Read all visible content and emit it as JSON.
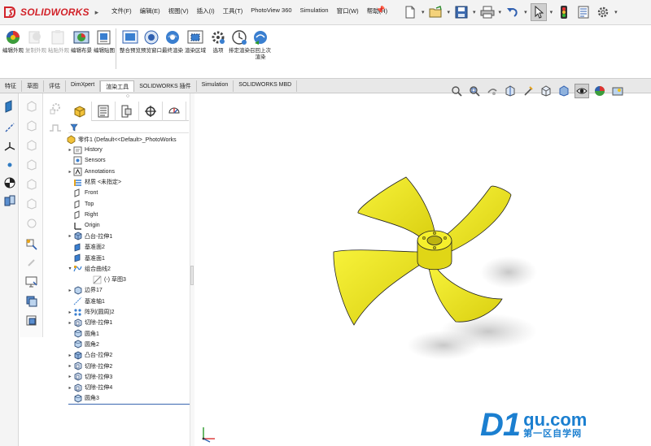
{
  "app": {
    "brand": "SOLIDWORKS",
    "menu": [
      "文件(F)",
      "编辑(E)",
      "视图(V)",
      "插入(I)",
      "工具(T)",
      "PhotoView 360",
      "Simulation",
      "窗口(W)",
      "帮助(H)"
    ]
  },
  "commands": [
    {
      "label": "编辑外观",
      "enabled": true
    },
    {
      "label": "复制外观",
      "enabled": false
    },
    {
      "label": "粘贴外观",
      "enabled": false
    },
    {
      "label": "编辑布景",
      "enabled": true
    },
    {
      "label": "编辑贴图",
      "enabled": true
    },
    {
      "label": "整合预览",
      "enabled": true
    },
    {
      "label": "预览窗口",
      "enabled": true
    },
    {
      "label": "最终渲染",
      "enabled": true
    },
    {
      "label": "渲染区域",
      "enabled": true
    },
    {
      "label": "选项",
      "enabled": true
    },
    {
      "label": "排定渲染",
      "enabled": true
    },
    {
      "label": "召回上次渲染",
      "enabled": true
    }
  ],
  "tabs": [
    "特征",
    "草图",
    "评估",
    "DimXpert",
    "渲染工具",
    "SOLIDWORKS 插件",
    "Simulation",
    "SOLIDWORKS MBD"
  ],
  "active_tab": "渲染工具",
  "tree": {
    "root": "零件1  (Default<<Default>_PhotoWorks",
    "items": [
      {
        "label": "History",
        "exp": "▸",
        "indent": 0,
        "icon": "history-icon"
      },
      {
        "label": "Sensors",
        "exp": "",
        "indent": 0,
        "icon": "sensors-icon"
      },
      {
        "label": "Annotations",
        "exp": "▸",
        "indent": 0,
        "icon": "annotations-icon"
      },
      {
        "label": "材质 <未指定>",
        "exp": "",
        "indent": 0,
        "icon": "material-icon"
      },
      {
        "label": "Front",
        "exp": "",
        "indent": 0,
        "icon": "plane-icon"
      },
      {
        "label": "Top",
        "exp": "",
        "indent": 0,
        "icon": "plane-icon"
      },
      {
        "label": "Right",
        "exp": "",
        "indent": 0,
        "icon": "plane-icon"
      },
      {
        "label": "Origin",
        "exp": "",
        "indent": 0,
        "icon": "origin-icon"
      },
      {
        "label": "凸台-拉伸1",
        "exp": "▸",
        "indent": 0,
        "icon": "extrude-icon"
      },
      {
        "label": "基准面2",
        "exp": "",
        "indent": 0,
        "icon": "ref-plane-icon"
      },
      {
        "label": "基准面1",
        "exp": "",
        "indent": 0,
        "icon": "ref-plane-icon"
      },
      {
        "label": "组合曲线2",
        "exp": "▾",
        "indent": 0,
        "icon": "curve-icon"
      },
      {
        "label": "(-) 草图3",
        "exp": "",
        "indent": 1,
        "icon": "sketch-icon"
      },
      {
        "label": "边界17",
        "exp": "▸",
        "indent": 0,
        "icon": "boundary-icon"
      },
      {
        "label": "基准轴1",
        "exp": "",
        "indent": 0,
        "icon": "axis-icon"
      },
      {
        "label": "阵列(圆周)2",
        "exp": "▸",
        "indent": 0,
        "icon": "pattern-icon"
      },
      {
        "label": "切除-拉伸1",
        "exp": "▸",
        "indent": 0,
        "icon": "cut-icon"
      },
      {
        "label": "圆角1",
        "exp": "",
        "indent": 0,
        "icon": "fillet-icon"
      },
      {
        "label": "圆角2",
        "exp": "",
        "indent": 0,
        "icon": "fillet-icon"
      },
      {
        "label": "凸台-拉伸2",
        "exp": "▸",
        "indent": 0,
        "icon": "extrude-icon"
      },
      {
        "label": "切除-拉伸2",
        "exp": "▸",
        "indent": 0,
        "icon": "cut-icon"
      },
      {
        "label": "切除-拉伸3",
        "exp": "▸",
        "indent": 0,
        "icon": "cut-icon"
      },
      {
        "label": "切除-拉伸4",
        "exp": "▸",
        "indent": 0,
        "icon": "cut-icon"
      },
      {
        "label": "圆角3",
        "exp": "",
        "indent": 0,
        "icon": "fillet-icon"
      }
    ]
  },
  "watermark": {
    "big": "D1",
    "domain": "qu.com",
    "slogan": "第一区自学网"
  },
  "colors": {
    "model": "#f2ec1e",
    "brand": "#d2232a",
    "watermark": "#1b7fd0"
  }
}
